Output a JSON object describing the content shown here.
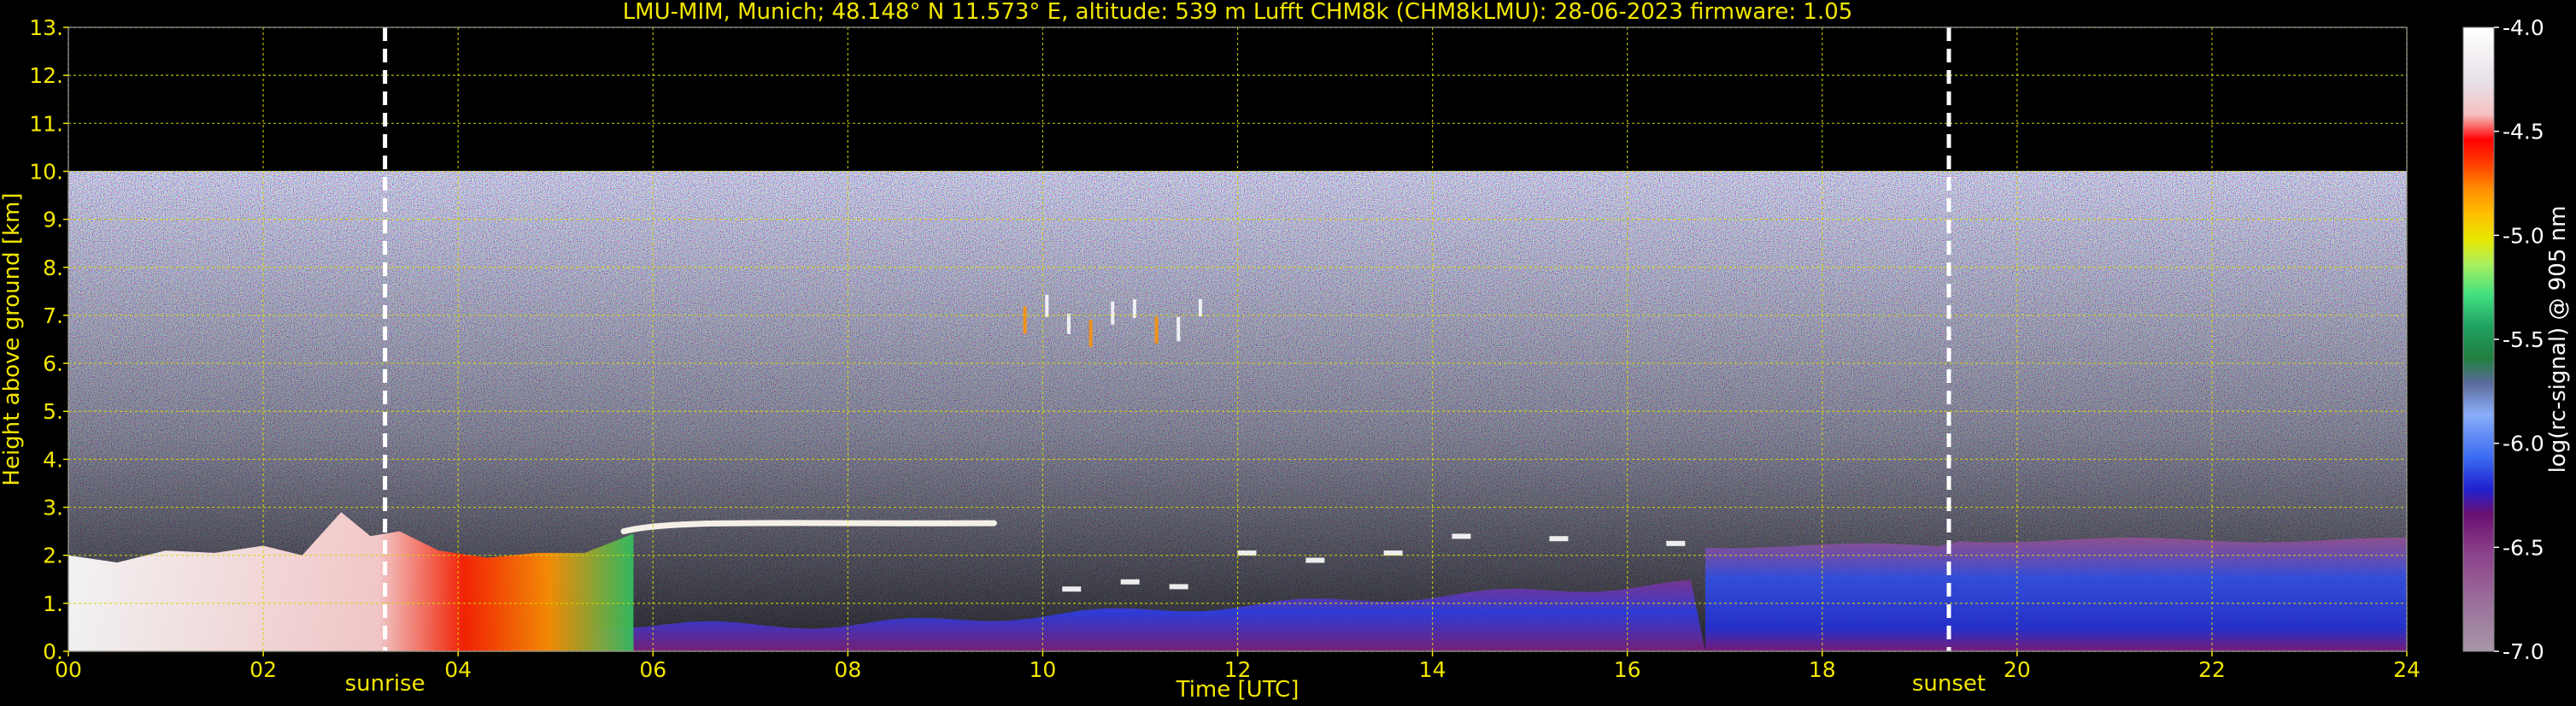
{
  "chart_data": {
    "type": "heatmap",
    "title": "LMU-MIM, Munich; 48.148° N 11.573° E, altitude: 539 m    Lufft CHM8k (CHM8kLMU): 28-06-2023    firmware: 1.05",
    "xlabel": "Time [UTC]",
    "ylabel": "Height above ground [km]",
    "colorbar_label": "log(rc-signal) @ 905 nm",
    "xlim": [
      0,
      24
    ],
    "ylim": [
      0,
      13
    ],
    "x_ticks": [
      "00",
      "02",
      "04",
      "06",
      "08",
      "10",
      "12",
      "14",
      "16",
      "18",
      "20",
      "22",
      "24"
    ],
    "y_ticks": [
      "0.",
      "1.",
      "2.",
      "3.",
      "4.",
      "5.",
      "6.",
      "7.",
      "8.",
      "9.",
      "10.",
      "11.",
      "12.",
      "13."
    ],
    "colorbar_range": [
      -7.0,
      -4.0
    ],
    "colorbar_ticks": [
      "-4.0",
      "-4.5",
      "-5.0",
      "-5.5",
      "-6.0",
      "-6.5",
      "-7.0"
    ],
    "grid": true,
    "data_ceiling_km": 10,
    "markers": [
      {
        "label": "sunrise",
        "x": 3.25
      },
      {
        "label": "sunset",
        "x": 19.3
      }
    ],
    "features": [
      {
        "kind": "boundary_layer_aerosol",
        "start": 0.0,
        "end": 5.8,
        "top": 2.3
      },
      {
        "kind": "elevated_layer",
        "start": 5.7,
        "end": 9.5,
        "height": 2.65
      },
      {
        "kind": "high_cloud",
        "start": 9.8,
        "end": 11.6,
        "height": 6.9
      },
      {
        "kind": "residual_layer",
        "start": 16.8,
        "end": 24.0,
        "top": 2.2
      }
    ],
    "colors": {
      "axis_text": "#f2e600",
      "grid": "#d8d800",
      "marker": "#ffffff",
      "colormap": [
        "#a897a8",
        "#9a5f9a",
        "#7a1f78",
        "#2a2fd2",
        "#3a6bf0",
        "#8aaefa",
        "#20a060",
        "#40e080",
        "#e8e800",
        "#ff9000",
        "#ff4000",
        "#ff0000",
        "#f5c0c0",
        "#ffffff"
      ]
    }
  }
}
